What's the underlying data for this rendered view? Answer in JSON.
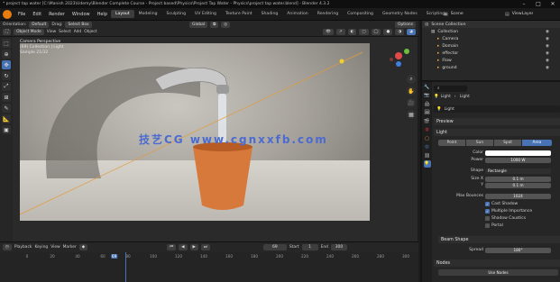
{
  "window": {
    "title": "* project tap water [C:\\Manish 2023\\Udemy\\Blender Complete Course - Project based\\Physics\\Project Tap Water - Physics\\project tap water.blend] - Blender 4.3.2",
    "minimize": "–",
    "maximize": "□",
    "close": "✕"
  },
  "menu": [
    "File",
    "Edit",
    "Render",
    "Window",
    "Help"
  ],
  "workspaces": [
    {
      "label": "Layout",
      "active": true
    },
    {
      "label": "Modeling"
    },
    {
      "label": "Sculpting"
    },
    {
      "label": "UV Editing"
    },
    {
      "label": "Texture Paint"
    },
    {
      "label": "Shading"
    },
    {
      "label": "Animation"
    },
    {
      "label": "Rendering"
    },
    {
      "label": "Compositing"
    },
    {
      "label": "Geometry Nodes"
    },
    {
      "label": "Scripting"
    }
  ],
  "scene": {
    "label": "Scene",
    "view_layer": "ViewLayer"
  },
  "viewport_toolbar": {
    "orientation_label": "Orientation:",
    "orientation": "Default",
    "drag_label": "Drag:",
    "drag": "Select Box",
    "transform": "Global",
    "options": "Options"
  },
  "viewport_header": {
    "mode": "Object Mode",
    "menus": [
      "View",
      "Select",
      "Add",
      "Object"
    ]
  },
  "viewport_overlay": {
    "line1": "Camera Perspective",
    "line2": "(69) Collection | Light",
    "line3": "Sample 21/32"
  },
  "watermark": "技艺CG  www.cgnxxfb.com",
  "timeline_header": {
    "menus": [
      "Playback",
      "Keying",
      "View",
      "Marker"
    ],
    "current_frame": "69",
    "start_label": "Start",
    "start": "1",
    "end_label": "End",
    "end": "300"
  },
  "timeline_ticks": [
    "0",
    "20",
    "40",
    "60",
    "69",
    "80",
    "100",
    "120",
    "140",
    "160",
    "180",
    "200",
    "220",
    "240",
    "260",
    "280",
    "300"
  ],
  "outliner": {
    "root": "Scene Collection",
    "items": [
      {
        "label": "Collection",
        "depth": 1
      },
      {
        "label": "Camera",
        "depth": 2,
        "color": "#e8a14b"
      },
      {
        "label": "Domain",
        "depth": 2,
        "color": "#e8a14b"
      },
      {
        "label": "effector",
        "depth": 2,
        "color": "#e8a14b"
      },
      {
        "label": "Flow",
        "depth": 2,
        "color": "#e8a14b"
      },
      {
        "label": "ground",
        "depth": 2,
        "color": "#e8a14b"
      }
    ]
  },
  "properties": {
    "breadcrumb_a": "Light",
    "breadcrumb_b": "Light",
    "datablock": "Light",
    "panels": {
      "preview": "Preview",
      "light": "Light",
      "beam_shape": "Beam Shape",
      "nodes": "Nodes"
    },
    "types": [
      "Point",
      "Sun",
      "Spot",
      "Area"
    ],
    "active_type": "Area",
    "color_label": "Color",
    "power_label": "Power",
    "power": "1000 W",
    "shape_label": "Shape",
    "shape": "Rectangle",
    "size_x_label": "Size X",
    "size_x": "0.1 m",
    "size_y_label": "Y",
    "size_y": "0.1 m",
    "max_bounces_label": "Max Bounces",
    "max_bounces": "1024",
    "cast_shadow": "Cast Shadow",
    "multiple_importance": "Multiple Importance",
    "shadow_caustics": "Shadow Caustics",
    "portal": "Portal",
    "spread_label": "Spread",
    "spread": "180°",
    "use_nodes": "Use Nodes"
  },
  "colors": {
    "accent": "#4772b3",
    "pot": "#d7793a",
    "light_color": "#ffffff"
  }
}
